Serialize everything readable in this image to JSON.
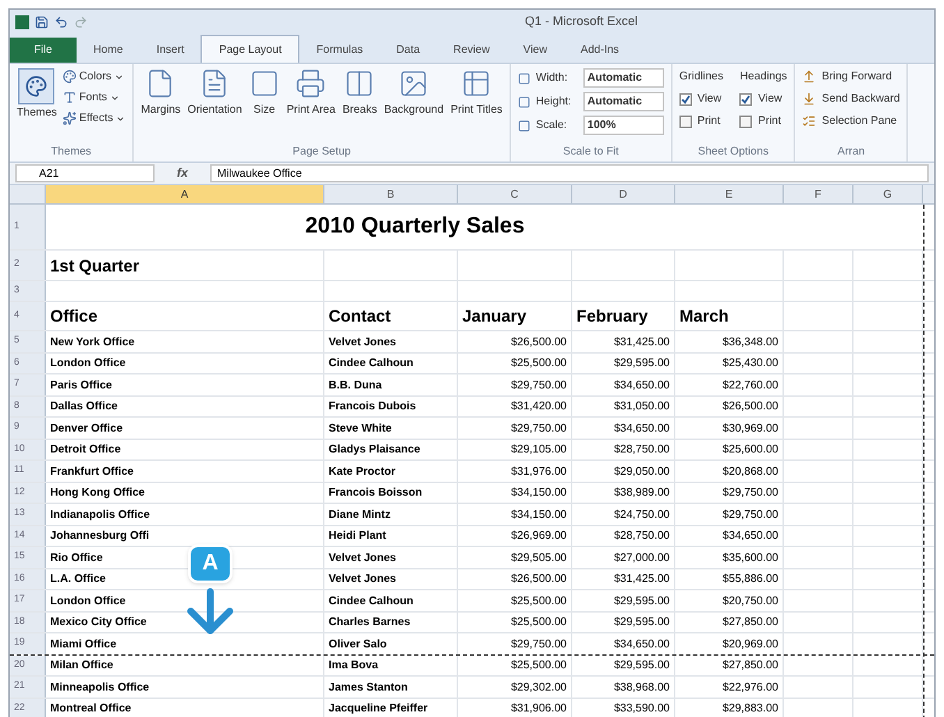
{
  "window": {
    "title": "Q1 - Microsoft Excel"
  },
  "tabs": [
    {
      "label": "File",
      "selected": false,
      "kind": "file"
    },
    {
      "label": "Home",
      "selected": false,
      "kind": "tab"
    },
    {
      "label": "Insert",
      "selected": false,
      "kind": "tab"
    },
    {
      "label": "Page Layout",
      "selected": true,
      "kind": "tab"
    },
    {
      "label": "Formulas",
      "selected": false,
      "kind": "tab"
    },
    {
      "label": "Data",
      "selected": false,
      "kind": "tab"
    },
    {
      "label": "Review",
      "selected": false,
      "kind": "tab"
    },
    {
      "label": "View",
      "selected": false,
      "kind": "tab"
    },
    {
      "label": "Add-Ins",
      "selected": false,
      "kind": "tab"
    }
  ],
  "ribbon": [
    {
      "label": "Themes",
      "kind": "themes",
      "large": {
        "label": "Themes"
      },
      "items": [
        {
          "label": "Colors"
        },
        {
          "label": "Fonts"
        },
        {
          "label": "Effects"
        }
      ]
    },
    {
      "label": "Page Setup",
      "kind": "buttons",
      "items": [
        {
          "label": "Margins"
        },
        {
          "label": "Orientation"
        },
        {
          "label": "Size"
        },
        {
          "label": "Print Area"
        },
        {
          "label": "Breaks"
        },
        {
          "label": "Background"
        },
        {
          "label": "Print Titles"
        }
      ]
    },
    {
      "label": "Scale to Fit",
      "kind": "scale",
      "items": [
        {
          "label": "Width:",
          "value": "Automatic"
        },
        {
          "label": "Height:",
          "value": "Automatic"
        },
        {
          "label": "Scale:",
          "value": "100%"
        }
      ]
    },
    {
      "label": "Sheet Options",
      "kind": "options",
      "items": [
        {
          "label": "Gridlines",
          "options": [
            {
              "label": "View",
              "checked": true
            },
            {
              "label": "Print",
              "checked": false
            }
          ]
        },
        {
          "label": "Headings",
          "options": [
            {
              "label": "View",
              "checked": true
            },
            {
              "label": "Print",
              "checked": false
            }
          ]
        }
      ]
    },
    {
      "label": "Arran",
      "kind": "arrange",
      "items": [
        {
          "label": "Bring Forward"
        },
        {
          "label": "Send Backward"
        },
        {
          "label": "Selection Pane"
        }
      ]
    }
  ],
  "formula_bar": {
    "name_box": "A21",
    "function_label": "fx",
    "value": "Milwaukee Office"
  },
  "columns": [
    {
      "label": "A",
      "selected": true
    },
    {
      "label": "B",
      "selected": false
    },
    {
      "label": "C",
      "selected": false
    },
    {
      "label": "D",
      "selected": false
    },
    {
      "label": "E",
      "selected": false
    },
    {
      "label": "F",
      "selected": false
    },
    {
      "label": "G",
      "selected": false
    }
  ],
  "rows": [
    {
      "number": "1",
      "kind": "title",
      "page_break": false,
      "cells": [
        "2010 Quarterly Sales"
      ]
    },
    {
      "number": "2",
      "kind": "subtitle",
      "page_break": false,
      "cells": [
        "1st Quarter"
      ]
    },
    {
      "number": "3",
      "kind": "blank",
      "page_break": false,
      "cells": []
    },
    {
      "number": "4",
      "kind": "header",
      "page_break": false,
      "cells": [
        "Office",
        "Contact",
        "January",
        "February",
        "March"
      ]
    },
    {
      "number": "5",
      "kind": "data",
      "page_break": false,
      "cells": [
        "New York Office",
        "Velvet Jones",
        "$26,500.00",
        "$31,425.00",
        "$36,348.00"
      ]
    },
    {
      "number": "6",
      "kind": "data",
      "page_break": false,
      "cells": [
        "London Office",
        "Cindee Calhoun",
        "$25,500.00",
        "$29,595.00",
        "$25,430.00"
      ]
    },
    {
      "number": "7",
      "kind": "data",
      "page_break": false,
      "cells": [
        "Paris Office",
        "B.B. Duna",
        "$29,750.00",
        "$34,650.00",
        "$22,760.00"
      ]
    },
    {
      "number": "8",
      "kind": "data",
      "page_break": false,
      "cells": [
        "Dallas Office",
        "Francois Dubois",
        "$31,420.00",
        "$31,050.00",
        "$26,500.00"
      ]
    },
    {
      "number": "9",
      "kind": "data",
      "page_break": false,
      "cells": [
        "Denver Office",
        "Steve White",
        "$29,750.00",
        "$34,650.00",
        "$30,969.00"
      ]
    },
    {
      "number": "10",
      "kind": "data",
      "page_break": false,
      "cells": [
        "Detroit Office",
        "Gladys Plaisance",
        "$29,105.00",
        "$28,750.00",
        "$25,600.00"
      ]
    },
    {
      "number": "11",
      "kind": "data",
      "page_break": false,
      "cells": [
        "Frankfurt Office",
        "Kate Proctor",
        "$31,976.00",
        "$29,050.00",
        "$20,868.00"
      ]
    },
    {
      "number": "12",
      "kind": "data",
      "page_break": false,
      "cells": [
        "Hong Kong Office",
        "Francois Boisson",
        "$34,150.00",
        "$38,989.00",
        "$29,750.00"
      ]
    },
    {
      "number": "13",
      "kind": "data",
      "page_break": false,
      "cells": [
        "Indianapolis Office",
        "Diane Mintz",
        "$34,150.00",
        "$24,750.00",
        "$29,750.00"
      ]
    },
    {
      "number": "14",
      "kind": "data",
      "page_break": false,
      "cells": [
        "Johannesburg Offi",
        "Heidi Plant",
        "$26,969.00",
        "$28,750.00",
        "$34,650.00"
      ]
    },
    {
      "number": "15",
      "kind": "data",
      "page_break": false,
      "cells": [
        "Rio Office",
        "Velvet Jones",
        "$29,505.00",
        "$27,000.00",
        "$35,600.00"
      ]
    },
    {
      "number": "16",
      "kind": "data",
      "page_break": false,
      "cells": [
        "L.A. Office",
        "Velvet Jones",
        "$26,500.00",
        "$31,425.00",
        "$55,886.00"
      ]
    },
    {
      "number": "17",
      "kind": "data",
      "page_break": false,
      "cells": [
        "London Office",
        "Cindee Calhoun",
        "$25,500.00",
        "$29,595.00",
        "$20,750.00"
      ]
    },
    {
      "number": "18",
      "kind": "data",
      "page_break": false,
      "cells": [
        "Mexico City Office",
        "Charles Barnes",
        "$25,500.00",
        "$29,595.00",
        "$27,850.00"
      ]
    },
    {
      "number": "19",
      "kind": "data",
      "page_break": true,
      "cells": [
        "Miami Office",
        "Oliver Salo",
        "$29,750.00",
        "$34,650.00",
        "$20,969.00"
      ]
    },
    {
      "number": "20",
      "kind": "data",
      "page_break": false,
      "cells": [
        "Milan Office",
        "Ima Bova",
        "$25,500.00",
        "$29,595.00",
        "$27,850.00"
      ]
    },
    {
      "number": "21",
      "kind": "data",
      "page_break": false,
      "cells": [
        "Minneapolis Office",
        "James Stanton",
        "$29,302.00",
        "$38,968.00",
        "$22,976.00"
      ]
    },
    {
      "number": "22",
      "kind": "data",
      "page_break": false,
      "cells": [
        "Montreal Office",
        "Jacqueline Pfeiffer",
        "$31,906.00",
        "$33,590.00",
        "$29,883.00"
      ]
    }
  ],
  "callout": {
    "label": "A"
  }
}
